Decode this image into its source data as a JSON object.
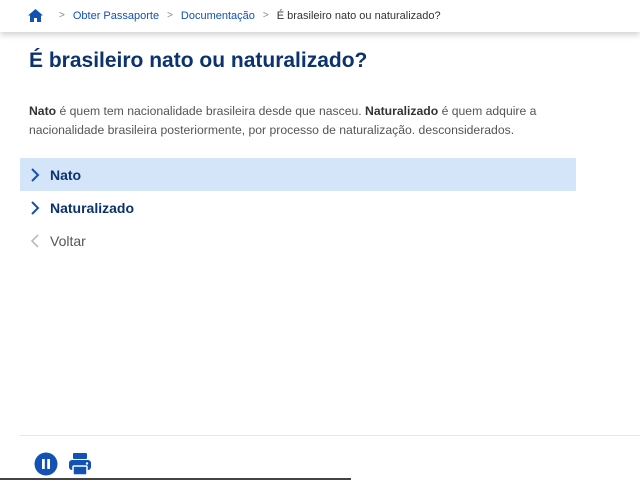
{
  "breadcrumb": {
    "home_icon": "home-icon",
    "items": [
      "Obter Passaporte",
      "Documentação"
    ],
    "current": "É brasileiro nato ou naturalizado?",
    "separator": ">"
  },
  "page": {
    "title": "É brasileiro nato ou naturalizado?",
    "intro": {
      "term1": "Nato",
      "text1": " é quem tem nacionalidade brasileira desde que nasceu. ",
      "term2": "Naturalizado",
      "text2": " é quem adquire a nacionalidade brasileira posteriormente, por processo de naturalização. desconsiderados."
    }
  },
  "options": [
    {
      "label": "Nato",
      "icon": "chevron-right-icon",
      "highlighted": true
    },
    {
      "label": "Naturalizado",
      "icon": "chevron-right-icon",
      "highlighted": false
    },
    {
      "label": "Voltar",
      "icon": "chevron-left-icon",
      "highlighted": false
    }
  ],
  "footer": {
    "icons": [
      "pause-icon",
      "print-icon"
    ]
  },
  "colors": {
    "primary_blue": "#1351b4",
    "title_navy": "#0c326f",
    "highlight": "#d4e5fa"
  }
}
